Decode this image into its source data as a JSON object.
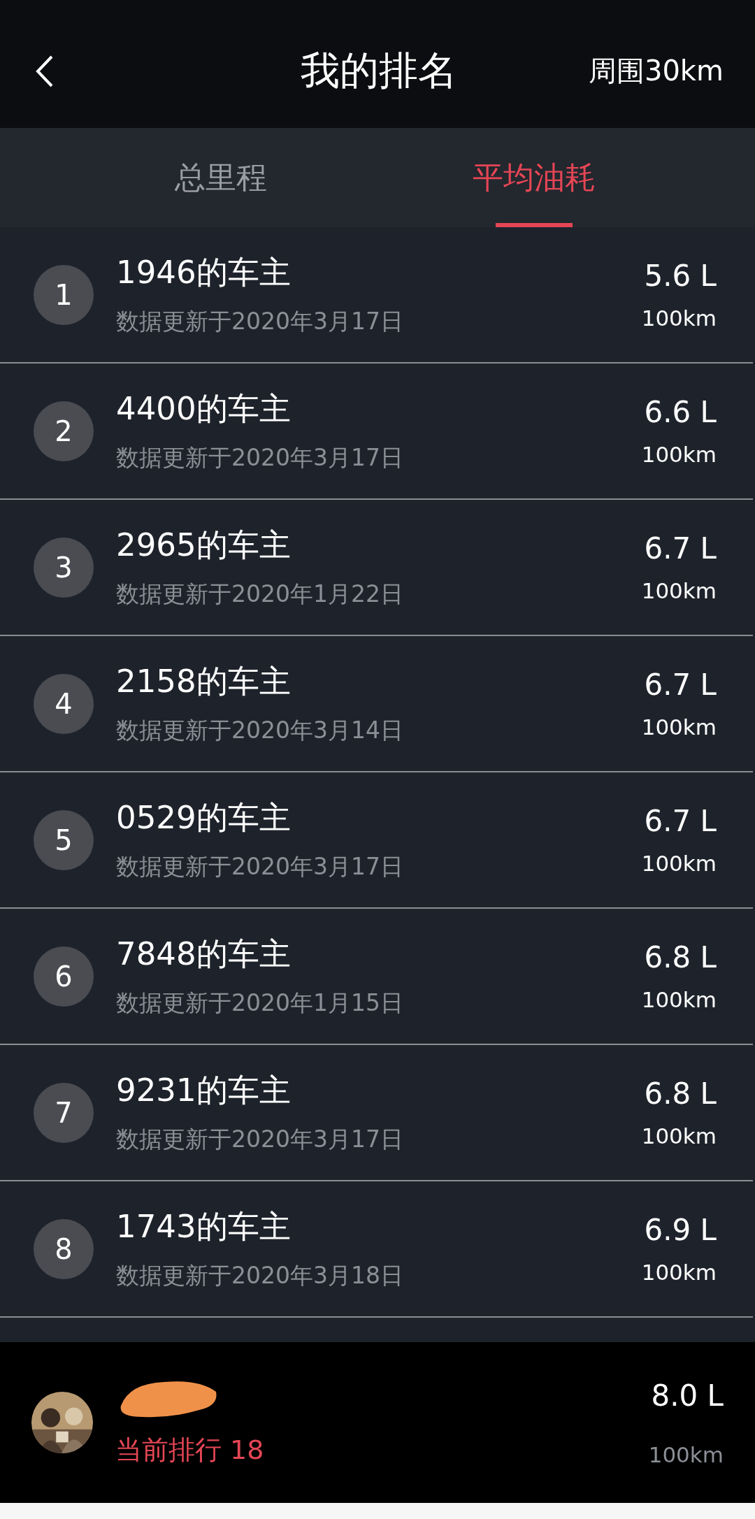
{
  "header": {
    "title": "我的排名",
    "range": "周围30km"
  },
  "tabs": [
    {
      "label": "总里程",
      "selected": false
    },
    {
      "label": "平均油耗",
      "selected": true
    }
  ],
  "rows": [
    {
      "rank": "1",
      "name": "1946的车主",
      "updated": "数据更新于2020年3月17日",
      "value": "5.6 L",
      "unit": "100km"
    },
    {
      "rank": "2",
      "name": "4400的车主",
      "updated": "数据更新于2020年3月17日",
      "value": "6.6 L",
      "unit": "100km"
    },
    {
      "rank": "3",
      "name": "2965的车主",
      "updated": "数据更新于2020年1月22日",
      "value": "6.7 L",
      "unit": "100km"
    },
    {
      "rank": "4",
      "name": "2158的车主",
      "updated": "数据更新于2020年3月14日",
      "value": "6.7 L",
      "unit": "100km"
    },
    {
      "rank": "5",
      "name": "0529的车主",
      "updated": "数据更新于2020年3月17日",
      "value": "6.7 L",
      "unit": "100km"
    },
    {
      "rank": "6",
      "name": "7848的车主",
      "updated": "数据更新于2020年1月15日",
      "value": "6.8 L",
      "unit": "100km"
    },
    {
      "rank": "7",
      "name": "9231的车主",
      "updated": "数据更新于2020年3月17日",
      "value": "6.8 L",
      "unit": "100km"
    },
    {
      "rank": "8",
      "name": "1743的车主",
      "updated": "数据更新于2020年3月18日",
      "value": "6.9 L",
      "unit": "100km"
    }
  ],
  "me": {
    "rank_text": "当前排行 18",
    "value": "8.0 L",
    "unit": "100km"
  }
}
